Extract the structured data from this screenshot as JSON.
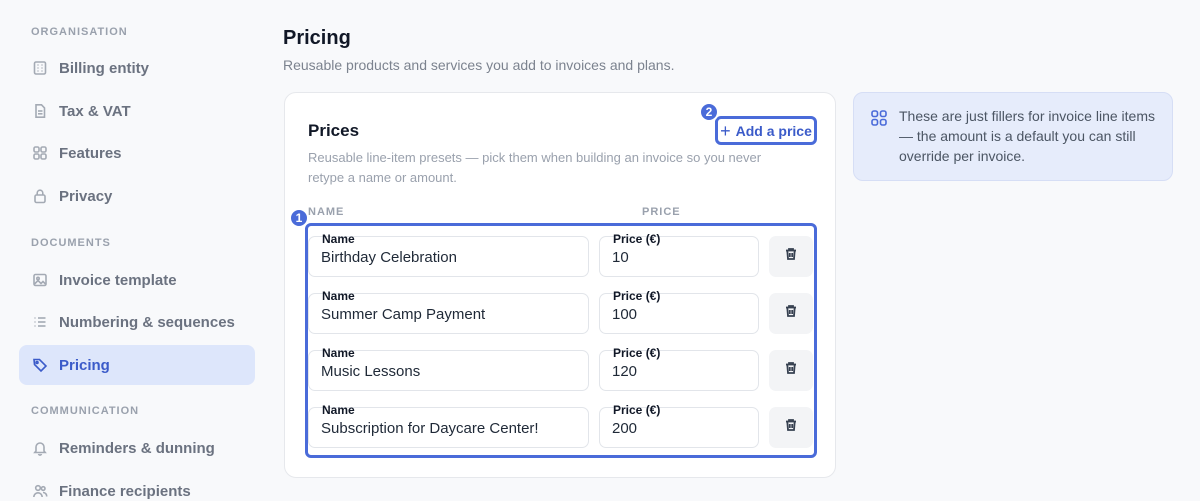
{
  "sidebar": {
    "sections": [
      {
        "label": "ORGANISATION"
      },
      {
        "label": "DOCUMENTS"
      },
      {
        "label": "COMMUNICATION"
      }
    ],
    "items": [
      {
        "label": "Billing entity",
        "icon": "building-icon"
      },
      {
        "label": "Tax & VAT",
        "icon": "document-icon"
      },
      {
        "label": "Features",
        "icon": "grid-icon"
      },
      {
        "label": "Privacy",
        "icon": "lock-icon"
      },
      {
        "label": "Invoice template",
        "icon": "image-icon"
      },
      {
        "label": "Numbering & sequences",
        "icon": "list-icon"
      },
      {
        "label": "Pricing",
        "icon": "tag-icon",
        "active": true
      },
      {
        "label": "Reminders & dunning",
        "icon": "bell-icon"
      },
      {
        "label": "Finance recipients",
        "icon": "users-icon"
      }
    ]
  },
  "header": {
    "title": "Pricing",
    "subtitle": "Reusable products and services you add to invoices and plans."
  },
  "card": {
    "title": "Prices",
    "description": "Reusable line-item presets — pick them when building an invoice so you never retype a name or amount.",
    "add_label": "Add a price",
    "col_name": "NAME",
    "col_price": "PRICE",
    "field_name_label": "Name",
    "field_price_label": "Price (€)",
    "rows": [
      {
        "name": "Birthday Celebration",
        "price": "10"
      },
      {
        "name": "Summer Camp Payment",
        "price": "100"
      },
      {
        "name": "Music Lessons",
        "price": "120"
      },
      {
        "name": "Subscription for Daycare Center!",
        "price": "200"
      }
    ]
  },
  "badges": {
    "one": "1",
    "two": "2"
  },
  "info": {
    "text": "These are just fillers for invoice line items — the amount is a default you can still override per invoice."
  },
  "colors": {
    "accent": "#4a6bd9",
    "active_bg": "#dde6fb",
    "info_bg": "#e6ecfb"
  }
}
